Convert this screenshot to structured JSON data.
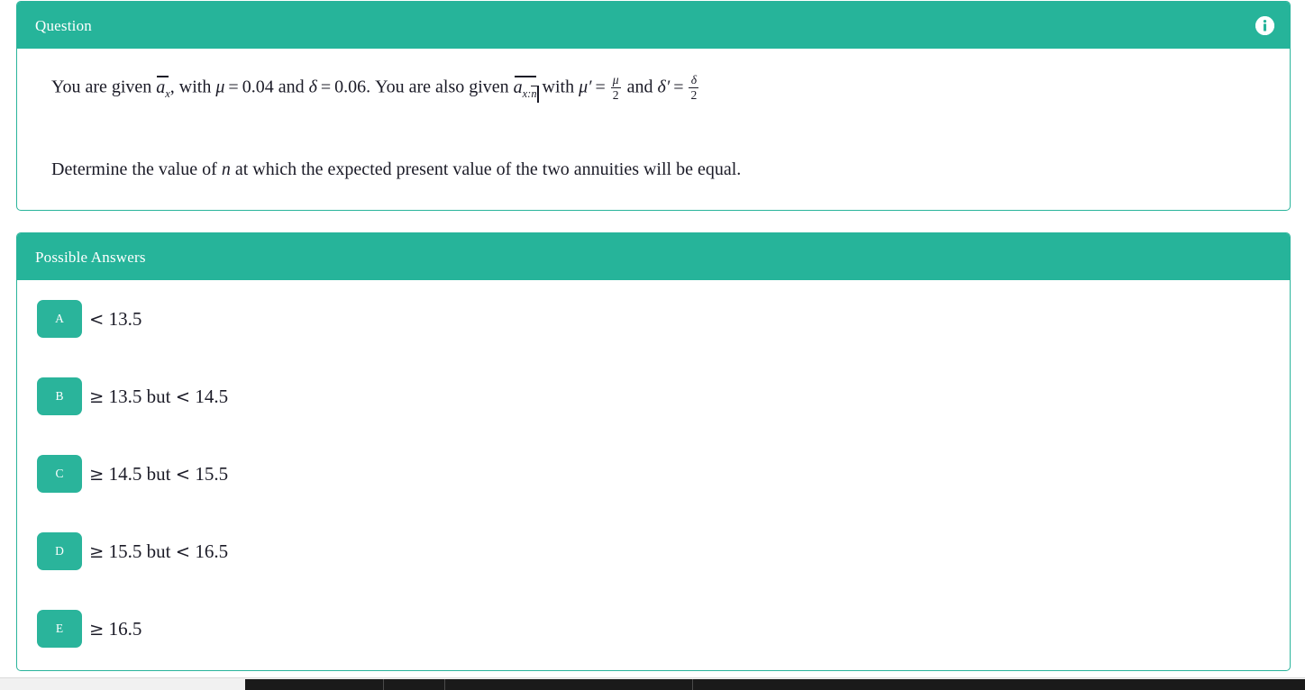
{
  "question_card": {
    "header_title": "Question",
    "info_icon": "info-circle-icon",
    "line1": {
      "t1": "You are given ",
      "a1": "a",
      "a1_sub": "x",
      "t2": ", with ",
      "mu": "μ",
      "eq1": "=",
      "mu_value": "0.04",
      "t3": " and ",
      "delta": "δ",
      "eq2": "=",
      "delta_value": "0.06",
      "t4": ". You are also given ",
      "a2": "a",
      "a2_sub_x": "x",
      "a2_sub_colon": ":",
      "a2_sub_n": "n",
      "t5": " with ",
      "mu_prime": "μ′",
      "eq3": "=",
      "frac1_num": "μ",
      "frac1_den": "2",
      "t6": " and ",
      "delta_prime": "δ′",
      "eq4": "=",
      "frac2_num": "δ",
      "frac2_den": "2"
    },
    "line2": {
      "t1": "Determine the value of ",
      "n": "n",
      "t2": " at which the expected present value of the two annuities will be equal."
    }
  },
  "answers_card": {
    "header_title": "Possible Answers",
    "options": [
      {
        "letter": "A",
        "rel1": "<",
        "val1": "13.5",
        "mid": "",
        "rel2": "",
        "val2": ""
      },
      {
        "letter": "B",
        "rel1": "≥",
        "val1": "13.5",
        "mid": "but",
        "rel2": "<",
        "val2": "14.5"
      },
      {
        "letter": "C",
        "rel1": "≥",
        "val1": "14.5",
        "mid": "but",
        "rel2": "<",
        "val2": "15.5"
      },
      {
        "letter": "D",
        "rel1": "≥",
        "val1": "15.5",
        "mid": "but",
        "rel2": "<",
        "val2": "16.5"
      },
      {
        "letter": "E",
        "rel1": "≥",
        "val1": "16.5",
        "mid": "",
        "rel2": "",
        "val2": ""
      }
    ]
  },
  "colors": {
    "accent": "#26b49a",
    "accent_border": "#2ab49b",
    "badge": "#2ab49b",
    "text": "#1b1b27",
    "card_background": "#ffffff",
    "page_background": "#ffffff",
    "scrollbar_track": "#f1f1f1",
    "scrollbar_thumb": "#1a1a1a"
  },
  "scrollbar": {
    "orientation": "horizontal",
    "position": "bottom"
  }
}
